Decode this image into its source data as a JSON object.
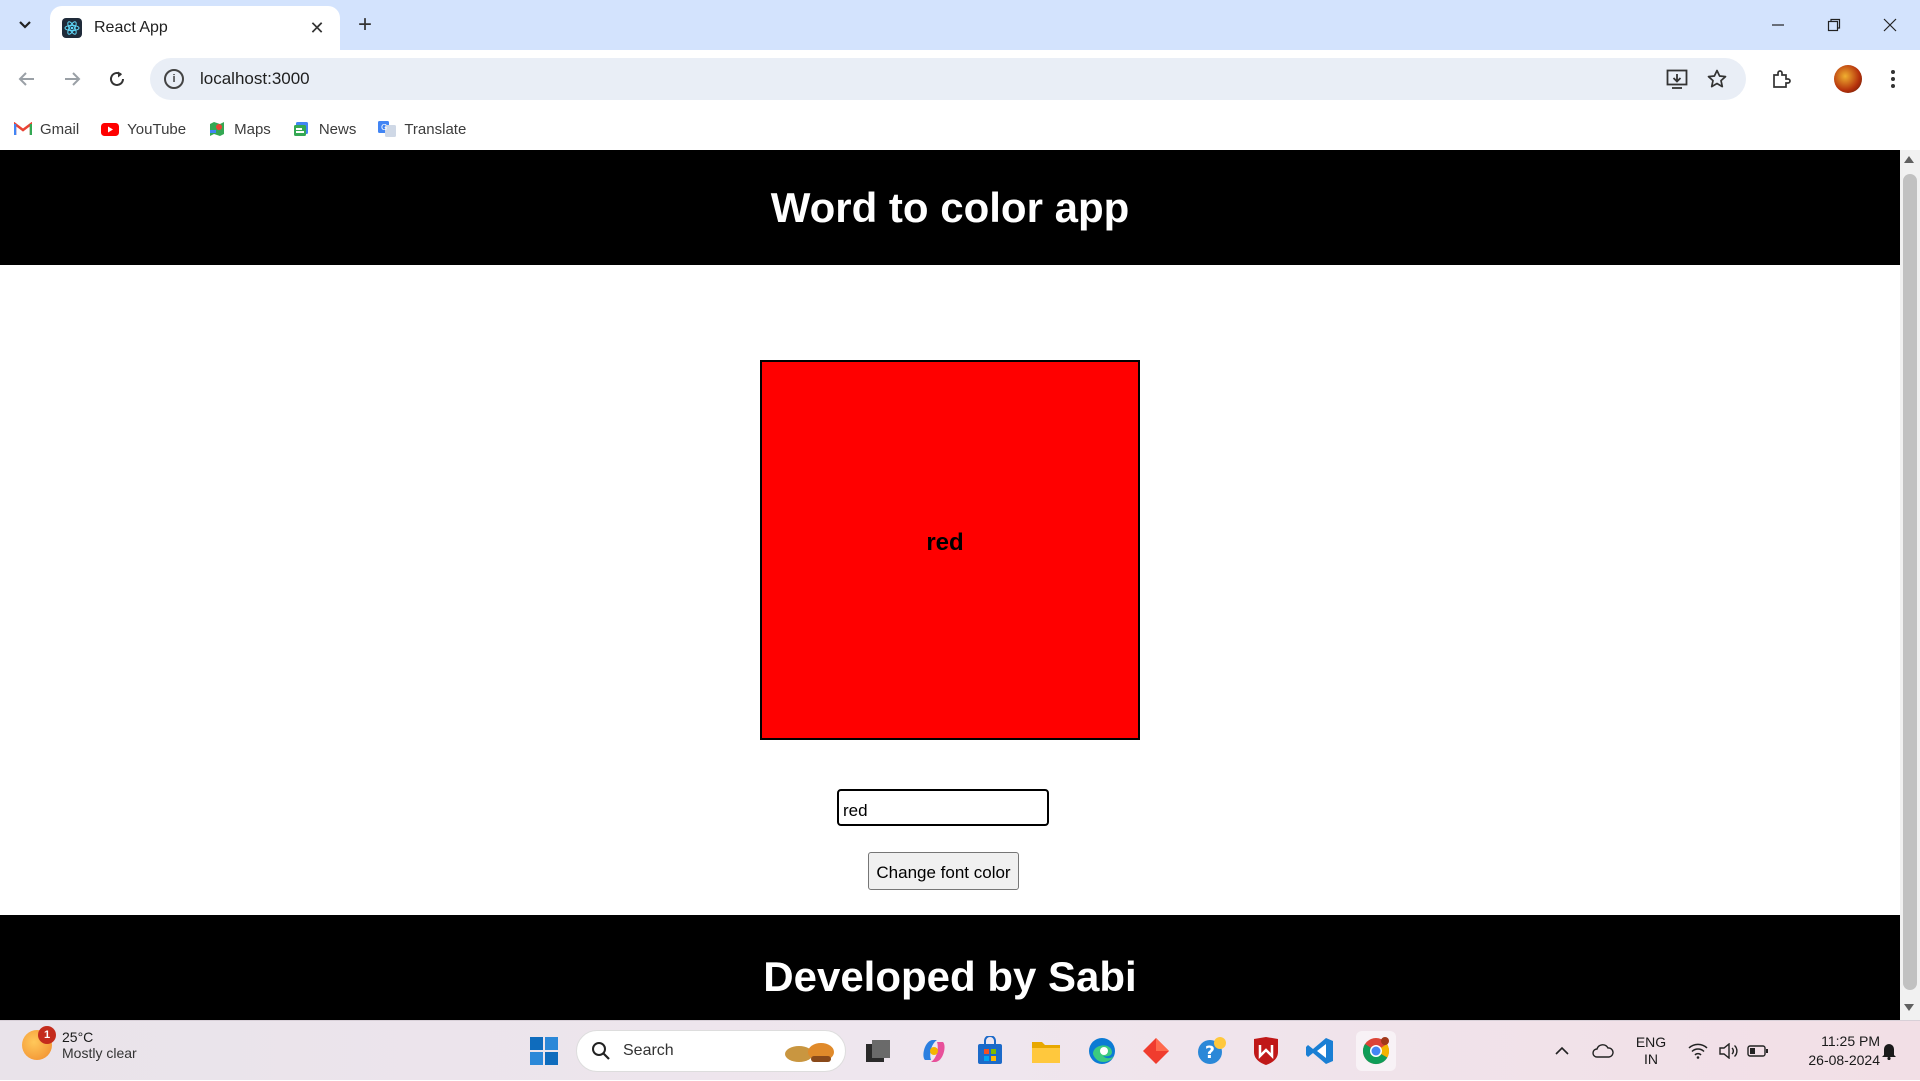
{
  "browser": {
    "tab_title": "React App",
    "url": "localhost:3000",
    "bookmarks": [
      {
        "label": "Gmail",
        "icon": "gmail-icon"
      },
      {
        "label": "YouTube",
        "icon": "youtube-icon"
      },
      {
        "label": "Maps",
        "icon": "maps-icon"
      },
      {
        "label": "News",
        "icon": "news-icon"
      },
      {
        "label": "Translate",
        "icon": "translate-icon"
      }
    ]
  },
  "page": {
    "header_title": "Word to color app",
    "box_word": "red",
    "box_color": "#ff0000",
    "input_value": "red",
    "button_label": "Change font color",
    "footer_text": "Developed by Sabi"
  },
  "taskbar": {
    "weather_temp": "25°C",
    "weather_desc": "Mostly clear",
    "weather_badge": "1",
    "search_label": "Search",
    "lang_line1": "ENG",
    "lang_line2": "IN",
    "time": "11:25 PM",
    "date": "26-08-2024"
  }
}
